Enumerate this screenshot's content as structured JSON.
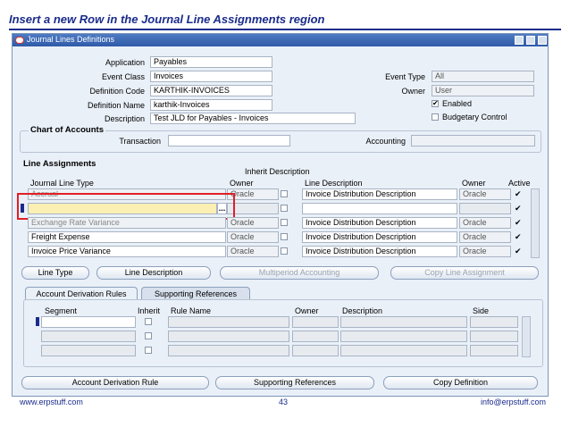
{
  "slide": {
    "title": "Insert a new Row in the Journal Line Assignments region"
  },
  "window": {
    "title": "Journal Lines Definitions"
  },
  "header": {
    "application_label": "Application",
    "application": "Payables",
    "event_class_label": "Event Class",
    "event_class": "Invoices",
    "definition_code_label": "Definition Code",
    "definition_code": "KARTHIK-INVOICES",
    "definition_name_label": "Definition Name",
    "definition_name": "karthik-Invoices",
    "description_label": "Description",
    "description": "Test JLD for Payables - Invoices",
    "event_type_label": "Event Type",
    "event_type": "All",
    "owner_label": "Owner",
    "owner": "User",
    "enabled_label": "Enabled",
    "enabled_checked": true,
    "budgetary_label": "Budgetary Control",
    "budgetary_checked": false
  },
  "coa": {
    "title": "Chart of Accounts",
    "transaction_label": "Transaction",
    "transaction": "",
    "accounting_label": "Accounting",
    "accounting": ""
  },
  "line_assignments": {
    "title": "Line Assignments",
    "inherit_desc_header": "Inherit Description",
    "columns": {
      "type": "Journal Line Type",
      "owner": "Owner",
      "desc": "Line Description",
      "owner2": "Owner",
      "active": "Active"
    },
    "rows": [
      {
        "type": "Accrual",
        "owner": "Oracle",
        "desc": "Invoice Distribution Description",
        "owner2": "Oracle",
        "active": "✔"
      },
      {
        "type": "",
        "owner": "",
        "desc": "",
        "owner2": "",
        "active": "✔"
      },
      {
        "type": "Exchange Rate Variance",
        "owner": "Oracle",
        "desc": "Invoice Distribution Description",
        "owner2": "Oracle",
        "active": "✔"
      },
      {
        "type": "Freight Expense",
        "owner": "Oracle",
        "desc": "Invoice Distribution Description",
        "owner2": "Oracle",
        "active": "✔"
      },
      {
        "type": "Invoice Price Variance",
        "owner": "Oracle",
        "desc": "Invoice Distribution Description",
        "owner2": "Oracle",
        "active": "✔"
      }
    ],
    "lov_button": "...",
    "buttons": {
      "line_type": "Line Type",
      "line_description": "Line Description",
      "multiperiod": "Multiperiod Accounting",
      "copy": "Copy Line Assignment"
    }
  },
  "tabs": {
    "account_derivation": "Account Derivation Rules",
    "supporting_refs": "Supporting References"
  },
  "derivation": {
    "columns": {
      "segment": "Segment",
      "inherit": "Inherit",
      "rule_name": "Rule Name",
      "owner": "Owner",
      "description": "Description",
      "side": "Side"
    },
    "row_count": 3
  },
  "bottom_buttons": {
    "adr": "Account Derivation Rule",
    "supporting": "Supporting References",
    "copy_def": "Copy Definition"
  },
  "footer": {
    "left": "www.erpstuff.com",
    "page": "43",
    "right": "info@erpstuff.com"
  }
}
